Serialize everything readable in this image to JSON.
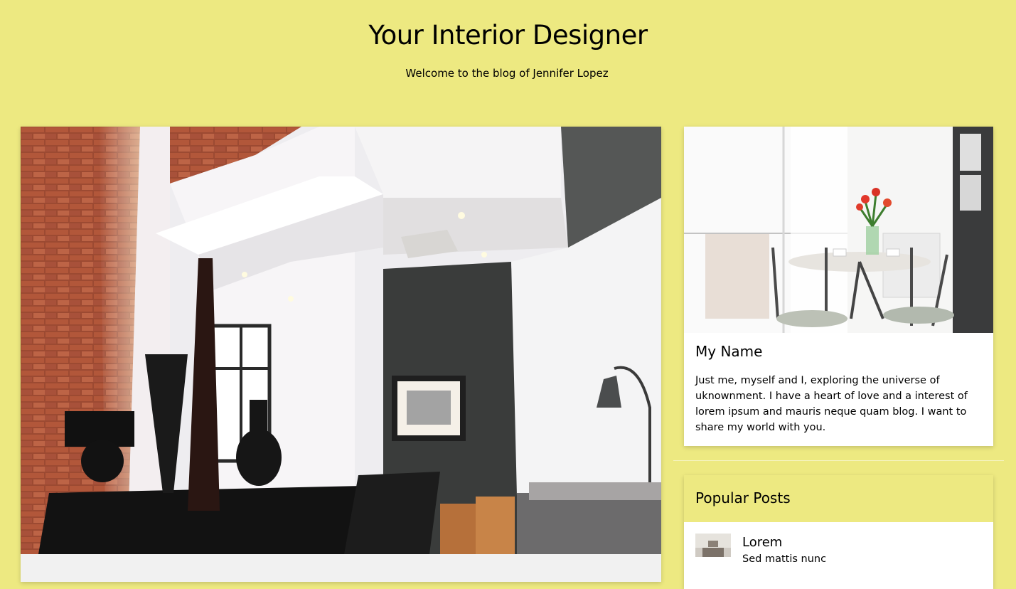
{
  "header": {
    "title": "Your Interior Designer",
    "tagline": "Welcome to the blog of Jennifer Lopez"
  },
  "hero": {
    "image_alt": "Modern interior with brick wall, black vases and lamp"
  },
  "profile": {
    "image_alt": "Bright dining room with round table and red tulips",
    "name": "My Name",
    "bio": "Just me, myself and I, exploring the universe of uknownment. I have a heart of love and a interest of lorem ipsum and mauris neque quam blog. I want to share my world with you."
  },
  "popular_posts": {
    "title": "Popular Posts",
    "items": [
      {
        "title": "Lorem",
        "subtitle": "Sed mattis nunc"
      }
    ]
  },
  "colors": {
    "background": "#ede981",
    "card": "#ffffff",
    "text": "#000000"
  }
}
